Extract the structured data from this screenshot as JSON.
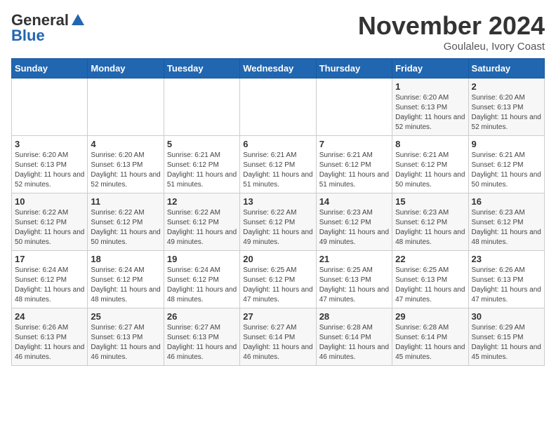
{
  "header": {
    "logo_general": "General",
    "logo_blue": "Blue",
    "title": "November 2024",
    "subtitle": "Goulaleu, Ivory Coast"
  },
  "weekdays": [
    "Sunday",
    "Monday",
    "Tuesday",
    "Wednesday",
    "Thursday",
    "Friday",
    "Saturday"
  ],
  "weeks": [
    [
      {
        "day": "",
        "info": ""
      },
      {
        "day": "",
        "info": ""
      },
      {
        "day": "",
        "info": ""
      },
      {
        "day": "",
        "info": ""
      },
      {
        "day": "",
        "info": ""
      },
      {
        "day": "1",
        "info": "Sunrise: 6:20 AM\nSunset: 6:13 PM\nDaylight: 11 hours and 52 minutes."
      },
      {
        "day": "2",
        "info": "Sunrise: 6:20 AM\nSunset: 6:13 PM\nDaylight: 11 hours and 52 minutes."
      }
    ],
    [
      {
        "day": "3",
        "info": "Sunrise: 6:20 AM\nSunset: 6:13 PM\nDaylight: 11 hours and 52 minutes."
      },
      {
        "day": "4",
        "info": "Sunrise: 6:20 AM\nSunset: 6:13 PM\nDaylight: 11 hours and 52 minutes."
      },
      {
        "day": "5",
        "info": "Sunrise: 6:21 AM\nSunset: 6:12 PM\nDaylight: 11 hours and 51 minutes."
      },
      {
        "day": "6",
        "info": "Sunrise: 6:21 AM\nSunset: 6:12 PM\nDaylight: 11 hours and 51 minutes."
      },
      {
        "day": "7",
        "info": "Sunrise: 6:21 AM\nSunset: 6:12 PM\nDaylight: 11 hours and 51 minutes."
      },
      {
        "day": "8",
        "info": "Sunrise: 6:21 AM\nSunset: 6:12 PM\nDaylight: 11 hours and 50 minutes."
      },
      {
        "day": "9",
        "info": "Sunrise: 6:21 AM\nSunset: 6:12 PM\nDaylight: 11 hours and 50 minutes."
      }
    ],
    [
      {
        "day": "10",
        "info": "Sunrise: 6:22 AM\nSunset: 6:12 PM\nDaylight: 11 hours and 50 minutes."
      },
      {
        "day": "11",
        "info": "Sunrise: 6:22 AM\nSunset: 6:12 PM\nDaylight: 11 hours and 50 minutes."
      },
      {
        "day": "12",
        "info": "Sunrise: 6:22 AM\nSunset: 6:12 PM\nDaylight: 11 hours and 49 minutes."
      },
      {
        "day": "13",
        "info": "Sunrise: 6:22 AM\nSunset: 6:12 PM\nDaylight: 11 hours and 49 minutes."
      },
      {
        "day": "14",
        "info": "Sunrise: 6:23 AM\nSunset: 6:12 PM\nDaylight: 11 hours and 49 minutes."
      },
      {
        "day": "15",
        "info": "Sunrise: 6:23 AM\nSunset: 6:12 PM\nDaylight: 11 hours and 48 minutes."
      },
      {
        "day": "16",
        "info": "Sunrise: 6:23 AM\nSunset: 6:12 PM\nDaylight: 11 hours and 48 minutes."
      }
    ],
    [
      {
        "day": "17",
        "info": "Sunrise: 6:24 AM\nSunset: 6:12 PM\nDaylight: 11 hours and 48 minutes."
      },
      {
        "day": "18",
        "info": "Sunrise: 6:24 AM\nSunset: 6:12 PM\nDaylight: 11 hours and 48 minutes."
      },
      {
        "day": "19",
        "info": "Sunrise: 6:24 AM\nSunset: 6:12 PM\nDaylight: 11 hours and 48 minutes."
      },
      {
        "day": "20",
        "info": "Sunrise: 6:25 AM\nSunset: 6:12 PM\nDaylight: 11 hours and 47 minutes."
      },
      {
        "day": "21",
        "info": "Sunrise: 6:25 AM\nSunset: 6:13 PM\nDaylight: 11 hours and 47 minutes."
      },
      {
        "day": "22",
        "info": "Sunrise: 6:25 AM\nSunset: 6:13 PM\nDaylight: 11 hours and 47 minutes."
      },
      {
        "day": "23",
        "info": "Sunrise: 6:26 AM\nSunset: 6:13 PM\nDaylight: 11 hours and 47 minutes."
      }
    ],
    [
      {
        "day": "24",
        "info": "Sunrise: 6:26 AM\nSunset: 6:13 PM\nDaylight: 11 hours and 46 minutes."
      },
      {
        "day": "25",
        "info": "Sunrise: 6:27 AM\nSunset: 6:13 PM\nDaylight: 11 hours and 46 minutes."
      },
      {
        "day": "26",
        "info": "Sunrise: 6:27 AM\nSunset: 6:13 PM\nDaylight: 11 hours and 46 minutes."
      },
      {
        "day": "27",
        "info": "Sunrise: 6:27 AM\nSunset: 6:14 PM\nDaylight: 11 hours and 46 minutes."
      },
      {
        "day": "28",
        "info": "Sunrise: 6:28 AM\nSunset: 6:14 PM\nDaylight: 11 hours and 46 minutes."
      },
      {
        "day": "29",
        "info": "Sunrise: 6:28 AM\nSunset: 6:14 PM\nDaylight: 11 hours and 45 minutes."
      },
      {
        "day": "30",
        "info": "Sunrise: 6:29 AM\nSunset: 6:15 PM\nDaylight: 11 hours and 45 minutes."
      }
    ]
  ]
}
